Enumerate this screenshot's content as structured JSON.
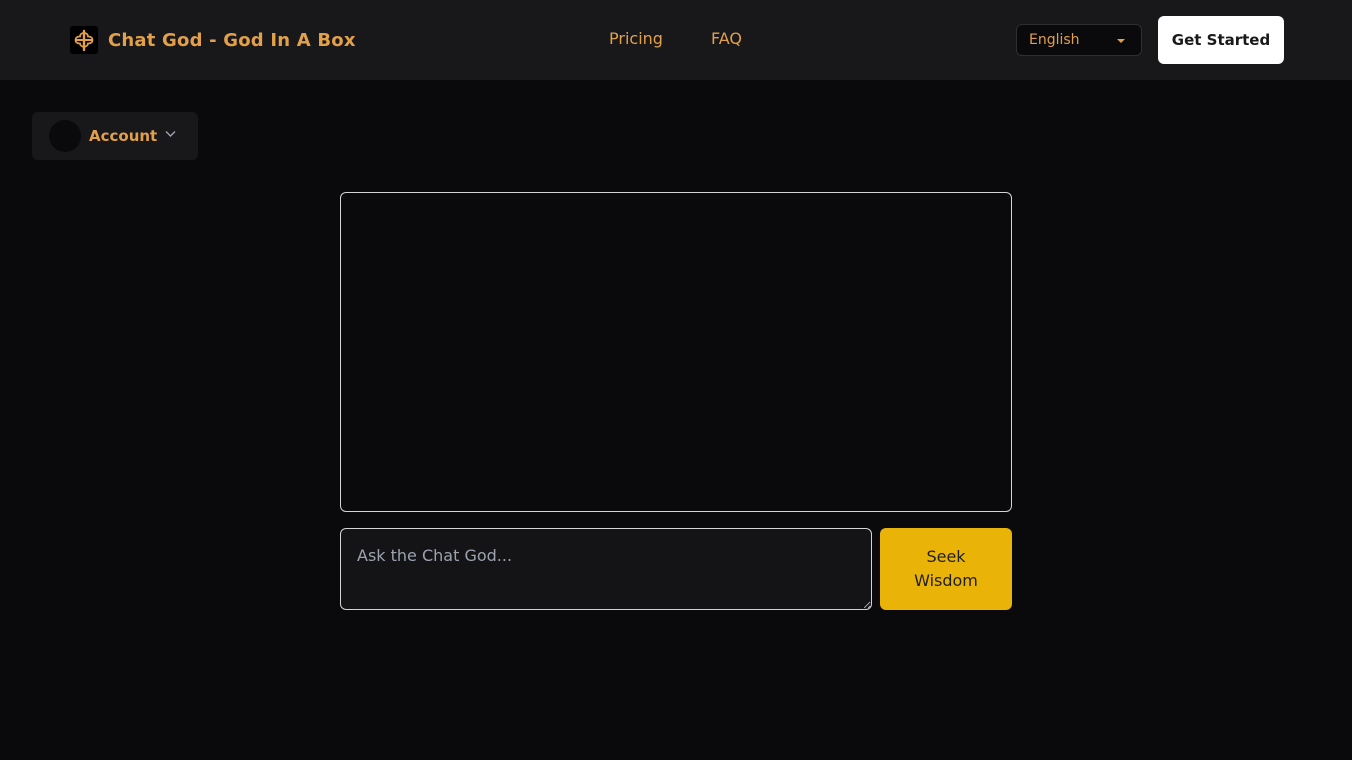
{
  "header": {
    "brand_title": "Chat God - God In A Box",
    "logo_icon": "cross-icon",
    "nav": [
      {
        "label": "Pricing"
      },
      {
        "label": "FAQ"
      }
    ],
    "language_selected": "English",
    "cta_label": "Get Started"
  },
  "account": {
    "label": "Account"
  },
  "chat": {
    "input_placeholder": "Ask the Chat God...",
    "input_value": "",
    "submit_label": "Seek Wisdom"
  },
  "colors": {
    "background": "#0a0a0c",
    "header_bg": "#18181b",
    "accent_gold": "#e2a04a",
    "button_yellow": "#eab308",
    "border": "#d4d4d8"
  }
}
